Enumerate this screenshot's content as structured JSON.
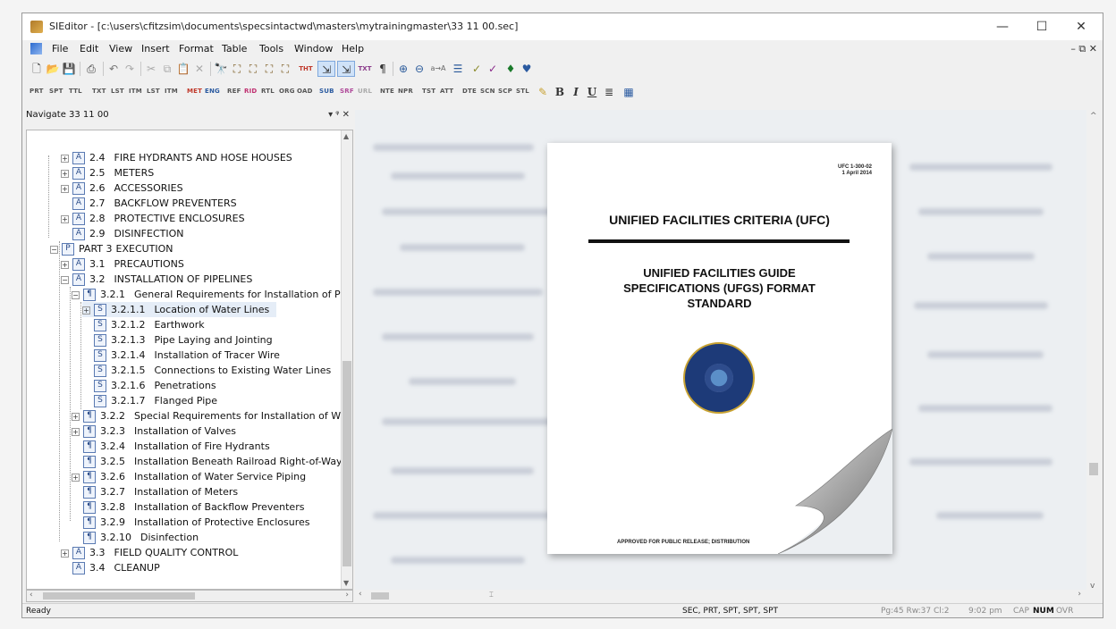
{
  "titlebar": {
    "title": "SIEditor - [c:\\users\\cfitzsim\\documents\\specsintactwd\\masters\\mytrainingmaster\\33 11 00.sec]",
    "minimize": "—",
    "maximize": "☐",
    "close": "✕"
  },
  "menu": {
    "items": [
      "File",
      "Edit",
      "View",
      "Insert",
      "Format",
      "Table",
      "Tools",
      "Window",
      "Help"
    ],
    "mdi_controls": "– ⧉ ✕"
  },
  "toolbar2": {
    "tags": [
      "PRT",
      "SPT",
      "TTL",
      "TXT",
      "LST",
      "ITM",
      "LST",
      "ITM",
      "MET",
      "ENG",
      "REF",
      "RID",
      "RTL",
      "ORG",
      "OAD",
      "SUB",
      "SRF",
      "URL",
      "NTE",
      "NPR",
      "TST",
      "ATT",
      "DTE",
      "SCN",
      "SCP",
      "STL"
    ],
    "bold": "B",
    "italic": "I",
    "underline": "U"
  },
  "navigator": {
    "title": "Navigate 33 11 00",
    "controls": "▾ ᵠ ✕",
    "rows": [
      {
        "exp": "+",
        "badge": "A",
        "num": "2.4",
        "label": "FIRE HYDRANTS AND HOSE HOUSES"
      },
      {
        "exp": "+",
        "badge": "A",
        "num": "2.5",
        "label": "METERS"
      },
      {
        "exp": "+",
        "badge": "A",
        "num": "2.6",
        "label": "ACCESSORIES"
      },
      {
        "exp": "",
        "badge": "A",
        "num": "2.7",
        "label": "BACKFLOW PREVENTERS"
      },
      {
        "exp": "+",
        "badge": "A",
        "num": "2.8",
        "label": "PROTECTIVE ENCLOSURES"
      },
      {
        "exp": "",
        "badge": "A",
        "num": "2.9",
        "label": "DISINFECTION"
      },
      {
        "exp": "−",
        "badge": "P",
        "num": "PART 3",
        "label": "EXECUTION"
      },
      {
        "exp": "+",
        "badge": "A",
        "num": "3.1",
        "label": "PRECAUTIONS"
      },
      {
        "exp": "−",
        "badge": "A",
        "num": "3.2",
        "label": "INSTALLATION OF PIPELINES"
      },
      {
        "exp": "−",
        "badge": "¶",
        "num": "3.2.1",
        "label": "General Requirements for Installation of Pipe"
      },
      {
        "exp": "+",
        "badge": "S",
        "num": "3.2.1.1",
        "label": "Location of Water Lines"
      },
      {
        "exp": "",
        "badge": "S",
        "num": "3.2.1.2",
        "label": "Earthwork"
      },
      {
        "exp": "",
        "badge": "S",
        "num": "3.2.1.3",
        "label": "Pipe Laying and Jointing"
      },
      {
        "exp": "",
        "badge": "S",
        "num": "3.2.1.4",
        "label": "Installation of Tracer Wire"
      },
      {
        "exp": "",
        "badge": "S",
        "num": "3.2.1.5",
        "label": "Connections to Existing Water Lines"
      },
      {
        "exp": "",
        "badge": "S",
        "num": "3.2.1.6",
        "label": "Penetrations"
      },
      {
        "exp": "",
        "badge": "S",
        "num": "3.2.1.7",
        "label": "Flanged Pipe"
      },
      {
        "exp": "+",
        "badge": "¶",
        "num": "3.2.2",
        "label": "Special Requirements for Installation of Wate"
      },
      {
        "exp": "+",
        "badge": "¶",
        "num": "3.2.3",
        "label": "Installation of Valves"
      },
      {
        "exp": "",
        "badge": "¶",
        "num": "3.2.4",
        "label": "Installation of Fire Hydrants"
      },
      {
        "exp": "",
        "badge": "¶",
        "num": "3.2.5",
        "label": "Installation Beneath Railroad Right-of-Way"
      },
      {
        "exp": "+",
        "badge": "¶",
        "num": "3.2.6",
        "label": "Installation of Water Service Piping"
      },
      {
        "exp": "",
        "badge": "¶",
        "num": "3.2.7",
        "label": "Installation of Meters"
      },
      {
        "exp": "",
        "badge": "¶",
        "num": "3.2.8",
        "label": "Installation of Backflow Preventers"
      },
      {
        "exp": "",
        "badge": "¶",
        "num": "3.2.9",
        "label": "Installation of Protective Enclosures"
      },
      {
        "exp": "",
        "badge": "¶",
        "num": "3.2.10",
        "label": "Disinfection"
      },
      {
        "exp": "+",
        "badge": "A",
        "num": "3.3",
        "label": "FIELD QUALITY CONTROL"
      },
      {
        "exp": "",
        "badge": "A",
        "num": "3.4",
        "label": "CLEANUP"
      }
    ]
  },
  "document_page": {
    "ufc_number": "UFC 1-300-02",
    "ufc_date": "1 April 2014",
    "title": "UNIFIED FACILITIES CRITERIA (UFC)",
    "subtitle_line1": "UNIFIED FACILITIES GUIDE",
    "subtitle_line2": "SPECIFICATIONS (UFGS) FORMAT",
    "subtitle_line3": "STANDARD",
    "approved": "APPROVED FOR PUBLIC RELEASE; DISTRIBUTION"
  },
  "statusbar": {
    "ready": "Ready",
    "tags": "SEC, PRT, SPT, SPT, SPT",
    "position": "Pg:45 Rw:37 Cl:2",
    "time": "9:02 pm",
    "cap": "CAP",
    "num": "NUM",
    "ovr": "OVR"
  },
  "colors": {
    "accent": "#2b4c8a",
    "selection": "#e5edf7",
    "seal_blue": "#1d3a78",
    "seal_gold": "#c8a232"
  }
}
